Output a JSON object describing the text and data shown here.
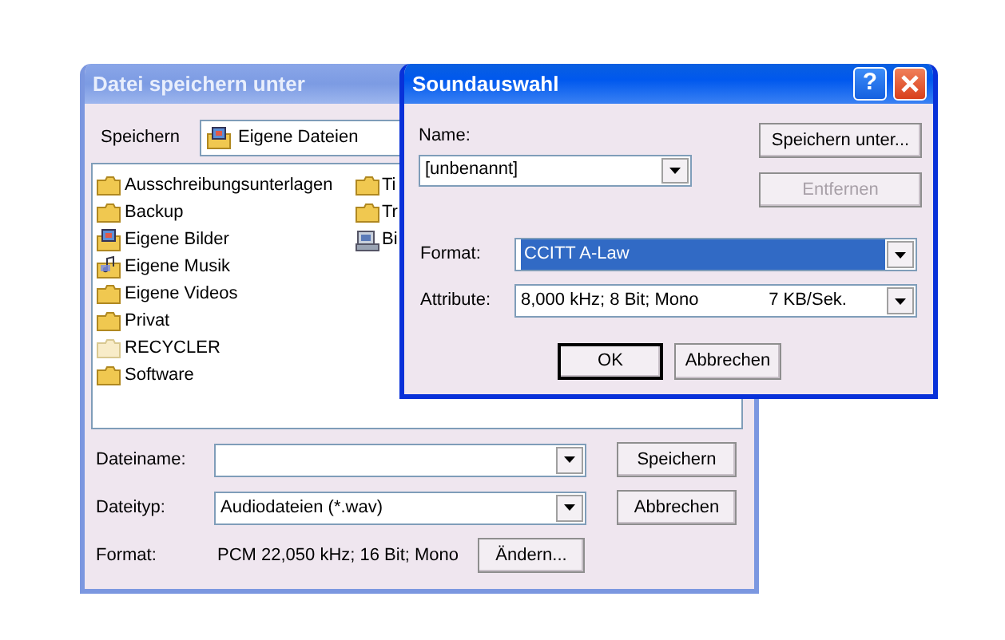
{
  "save_dialog": {
    "title": "Datei speichern unter",
    "active": false,
    "save_in": {
      "label": "Speichern",
      "value": "Eigene Dateien"
    },
    "files": [
      {
        "name": "Ausschreibungsunterlagen",
        "kind": "folder"
      },
      {
        "name": "Backup",
        "kind": "folder"
      },
      {
        "name": "Eigene Bilder",
        "kind": "pictures"
      },
      {
        "name": "Eigene Musik",
        "kind": "music"
      },
      {
        "name": "Eigene Videos",
        "kind": "folder"
      },
      {
        "name": "Privat",
        "kind": "folder"
      },
      {
        "name": "RECYCLER",
        "kind": "hidden"
      },
      {
        "name": "Software",
        "kind": "folder"
      },
      {
        "name": "Ti",
        "kind": "folder"
      },
      {
        "name": "Tr",
        "kind": "folder"
      },
      {
        "name": "Bi",
        "kind": "computer"
      }
    ],
    "filename": {
      "label": "Dateiname:"
    },
    "filetype": {
      "label": "Dateityp:",
      "value": "Audiodateien (*.wav)"
    },
    "format": {
      "label": "Format:",
      "value": "PCM 22,050 kHz; 16 Bit; Mono"
    },
    "save_button": "Speichern",
    "cancel_button": "Abbrechen",
    "change_button": "Ändern..."
  },
  "sound_dialog": {
    "title": "Soundauswahl",
    "active": true,
    "help_button": "?",
    "name": {
      "label": "Name:",
      "value": "[unbenannt]"
    },
    "side_buttons": [
      {
        "label": "Speichern unter...",
        "disabled": false
      },
      {
        "label": "Entfernen",
        "disabled": true
      }
    ],
    "format": {
      "label": "Format:",
      "value": "CCITT A-Law",
      "highlighted": true
    },
    "attributes": {
      "label": "Attribute:",
      "value": "8,000 kHz; 8 Bit; Mono",
      "rate": "7 KB/Sek."
    },
    "bottom_buttons": [
      {
        "label": "OK",
        "default": true
      },
      {
        "label": "Abbrechen",
        "default": false
      }
    ]
  }
}
